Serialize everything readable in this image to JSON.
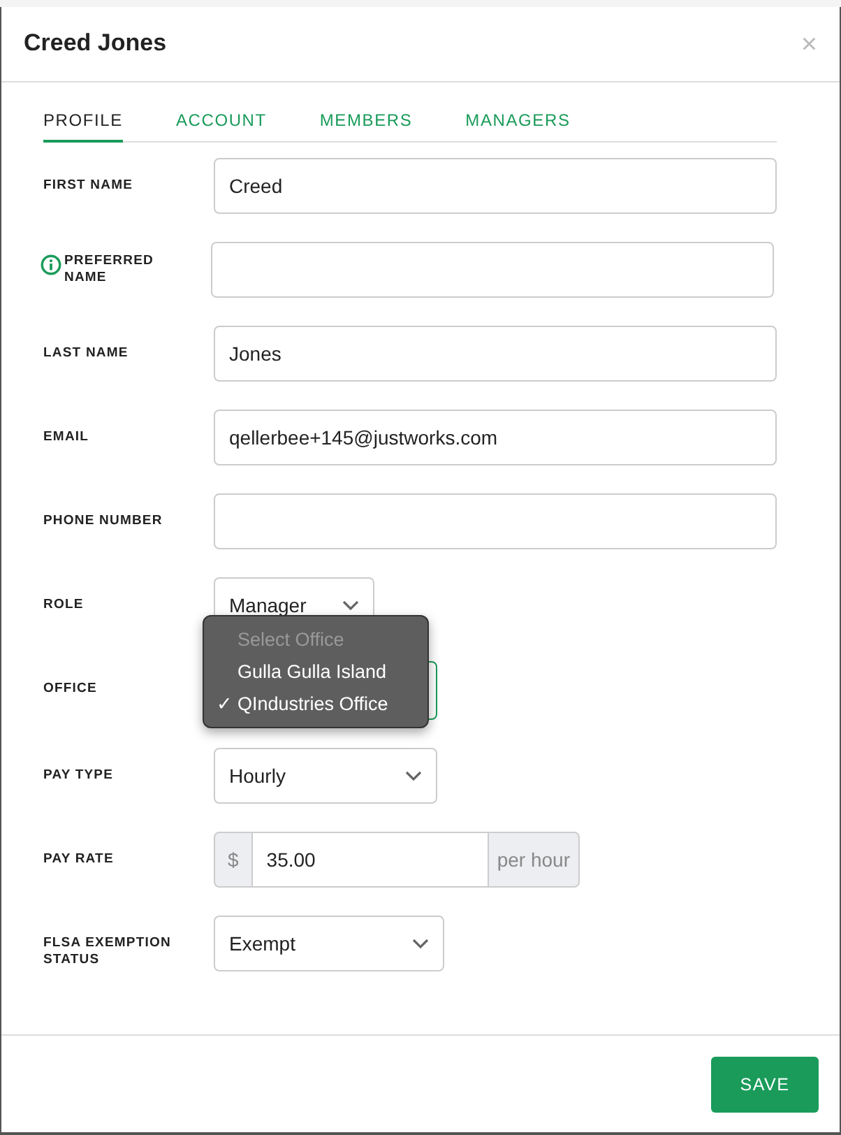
{
  "modal": {
    "title": "Creed Jones",
    "close": "×"
  },
  "tabs": [
    {
      "label": "PROFILE",
      "selected": true
    },
    {
      "label": "ACCOUNT",
      "selected": false
    },
    {
      "label": "MEMBERS",
      "selected": false
    },
    {
      "label": "MANAGERS",
      "selected": false
    }
  ],
  "fields": [
    {
      "kind": "text",
      "label": "FIRST NAME",
      "value": "Creed"
    },
    {
      "kind": "text",
      "label": "PREFERRED NAME",
      "info": true
    },
    {
      "kind": "text",
      "label": "LAST NAME",
      "value": "Jones"
    },
    {
      "kind": "text",
      "label": "EMAIL",
      "value": "qellerbee+145@justworks.com"
    },
    {
      "kind": "text",
      "label": "PHONE NUMBER"
    },
    {
      "kind": "select",
      "label": "ROLE",
      "value": "Manager"
    },
    {
      "kind": "select",
      "label": "OFFICE",
      "open": true,
      "menu": {
        "check_mark": "✓",
        "options": [
          {
            "label": "Select Office",
            "disabled": true,
            "selected": false
          },
          {
            "label": "Gulla Gulla Island",
            "disabled": false,
            "selected": false
          },
          {
            "label": "QIndustries Office",
            "disabled": false,
            "selected": true
          }
        ]
      }
    },
    {
      "kind": "select",
      "label": "PAY TYPE",
      "value": "Hourly"
    },
    {
      "kind": "currency",
      "label": "PAY RATE",
      "prefix": "$",
      "value": "35.00",
      "suffix": "per hour"
    },
    {
      "kind": "select",
      "label": "FLSA EXEMPTION STATUS",
      "value": "Exempt"
    }
  ],
  "footer": {
    "save": "SAVE"
  }
}
